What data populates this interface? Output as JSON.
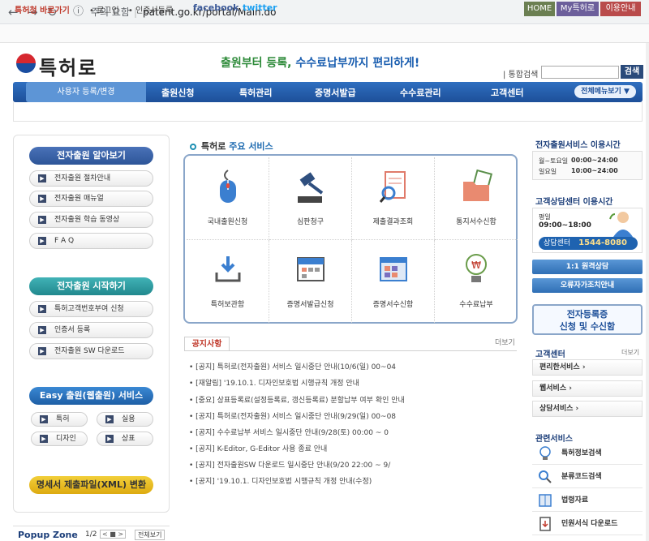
{
  "browser": {
    "security": "주의 요함",
    "separator": "|",
    "url": "patent.go.kr/portal/Main.do"
  },
  "util": {
    "bookmark": "특허청 바로가기",
    "login": "• 로그인",
    "cert": "• 인증서등록",
    "facebook": "facebook",
    "twitter": "twitter",
    "home": "HOME",
    "my": "My특허로",
    "guide": "이용안내"
  },
  "header": {
    "logo": "특허로",
    "slogan_a": "출원부터 등록, ",
    "slogan_b": "수수료납부까지 편리하게!",
    "search_label": "| 통합검색",
    "search_btn": "검색"
  },
  "nav": {
    "register": "사용자 등록/변경",
    "items": [
      "출원신청",
      "특허관리",
      "증명서발급",
      "수수료관리",
      "고객센터"
    ],
    "allmenu": "전체메뉴보기 ▼"
  },
  "left": {
    "sec1": {
      "title": "전자출원 알아보기",
      "items": [
        "전자출원 절차안내",
        "전자출원 매뉴얼",
        "전자출원 학습 동영상",
        "F A Q"
      ]
    },
    "sec2": {
      "title": "전자출원 시작하기",
      "items": [
        "특허고객번호부여 신청",
        "인증서 등록",
        "전자출원 SW 다운로드"
      ]
    },
    "sec3": {
      "title": "Easy 출원(웹출원) 서비스",
      "items": [
        "특허",
        "실용",
        "디자인",
        "상표"
      ]
    },
    "xml": "명세서 제출파일(XML) 변환",
    "popup": {
      "title": "Popup Zone",
      "page": "1/2",
      "ctrl": "< ■ >",
      "all": "전체보기"
    }
  },
  "services": {
    "title_a": "특허로 ",
    "title_b": "주요 서비스",
    "items": [
      "국내출원신청",
      "심판청구",
      "제출결과조회",
      "통지서수신함",
      "특허보관함",
      "증명서발급신청",
      "증명서수신함",
      "수수료납부"
    ]
  },
  "notice": {
    "tab": "공지사항",
    "more": "더보기",
    "items": [
      "• [공지] 특허로(전자출원) 서비스 일시중단 안내(10/6(일) 00~04",
      "• [재알림] '19.10.1. 디자인보호법 시행규칙 개정 안내",
      "• [중요] 상표등록료(설정등록료, 갱신등록료) 분할납부 여부 확인 안내",
      "• [공지] 특허로(전자출원) 서비스 일시중단 안내(9/29(일) 00~08",
      "• [공지] 수수료납부 서비스 일시중단 안내(9/28(토) 00:00 ~ 0",
      "• [공지] K-Editor, G-Editor 사용 종료 안내",
      "• [공지] 전자출원SW 다운로드 일시중단 안내(9/20 22:00 ~ 9/",
      "• [공지] '19.10.1. 디자인보호법 시행규칙 개정 안내(수정)"
    ]
  },
  "right": {
    "hours_title": "전자출원서비스 이용시간",
    "weekday_label": "월~토요일",
    "weekday_time": "00:00~24:00",
    "sunday_label": "일요일",
    "sunday_time": "10:00~24:00",
    "cs_title": "고객상담센터 이용시간",
    "cs_label": "평일",
    "cs_hours": "09:00~18:00",
    "cs_center": "상담센터",
    "cs_phone": "1544-8080",
    "remote": "1:1 원격상담",
    "error": "오류자가조치안내",
    "cert_a": "전자등록증",
    "cert_b": "신청 및 수신함",
    "support_title": "고객센터",
    "support_more": "더보기",
    "support_items": [
      "편리한서비스 ›",
      "웹서비스 ›",
      "상담서비스 ›"
    ],
    "related_title": "관련서비스",
    "related_items": [
      "특허정보검색",
      "분류코드검색",
      "법령자료",
      "민원서식 다운로드"
    ]
  },
  "colors": {
    "nav": "#1d4f99",
    "accent": "#1d6ab0",
    "notice": "#c0392b"
  }
}
